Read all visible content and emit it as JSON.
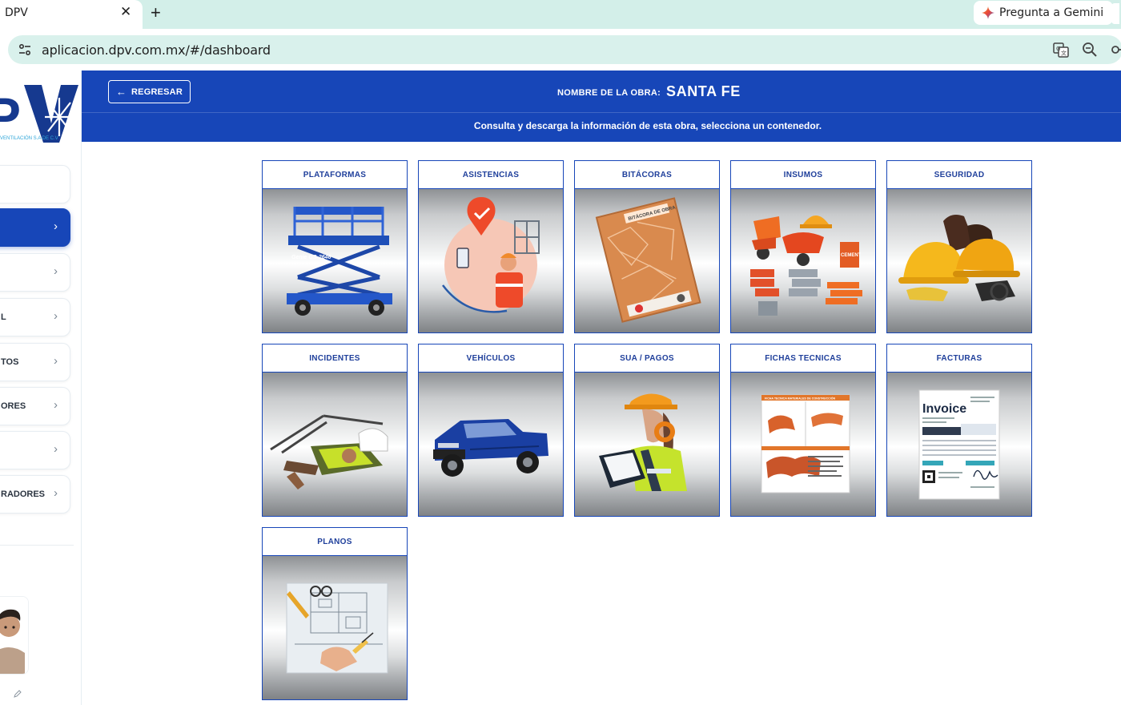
{
  "browser": {
    "tab_title": "DPV",
    "tab_close": "✕",
    "new_tab": "+",
    "gemini_label": "Pregunta a Gemini",
    "url_host": "aplicacion.dpv.com.mx",
    "url_path": "/#/dashboard"
  },
  "sidebar": {
    "logo_text": "PV",
    "logo_subtitle": "VENTILACIÓN S.A DE C.V",
    "items": [
      {
        "label": ""
      },
      {
        "label": "",
        "active": true
      },
      {
        "label": ""
      },
      {
        "label": "L"
      },
      {
        "label": "TOS"
      },
      {
        "label": "ORES"
      },
      {
        "label": ""
      },
      {
        "label": "RADORES"
      }
    ],
    "chevron": "›"
  },
  "header": {
    "back_label": "REGRESAR",
    "back_arrow": "←",
    "obra_label": "NOMBRE DE LA OBRA:",
    "obra_name": "SANTA FE",
    "subtitle": "Consulta y descarga la información de esta obra, selecciona un contenedor."
  },
  "cards": [
    {
      "title": "PLATAFORMAS",
      "icon": "scissor-lift-image"
    },
    {
      "title": "ASISTENCIAS",
      "icon": "attendance-image"
    },
    {
      "title": "BITÁCORAS",
      "icon": "logbook-image"
    },
    {
      "title": "INSUMOS",
      "icon": "supplies-image"
    },
    {
      "title": "SEGURIDAD",
      "icon": "safety-gear-image"
    },
    {
      "title": "INCIDENTES",
      "icon": "incident-image"
    },
    {
      "title": "VEHÍCULOS",
      "icon": "pickup-truck-image"
    },
    {
      "title": "SUA / PAGOS",
      "icon": "worker-clipboard-image"
    },
    {
      "title": "FICHAS TECNICAS",
      "icon": "tech-sheet-image"
    },
    {
      "title": "FACTURAS",
      "icon": "invoice-image"
    },
    {
      "title": "PLANOS",
      "icon": "blueprint-image"
    }
  ],
  "image_text": {
    "lift_model": "Genie GS-2646",
    "logbook_label": "BITÁCORA DE OBRA",
    "cement_label": "CEMENT",
    "invoice_heading": "Invoice",
    "sheet_heading": "FICHA TECNICA MATERIALES DE CONSTRUCCIÓN"
  },
  "colors": {
    "brand_blue": "#1746b8",
    "tab_bar": "#d3efe9",
    "omnibox": "#d9f1ec"
  }
}
